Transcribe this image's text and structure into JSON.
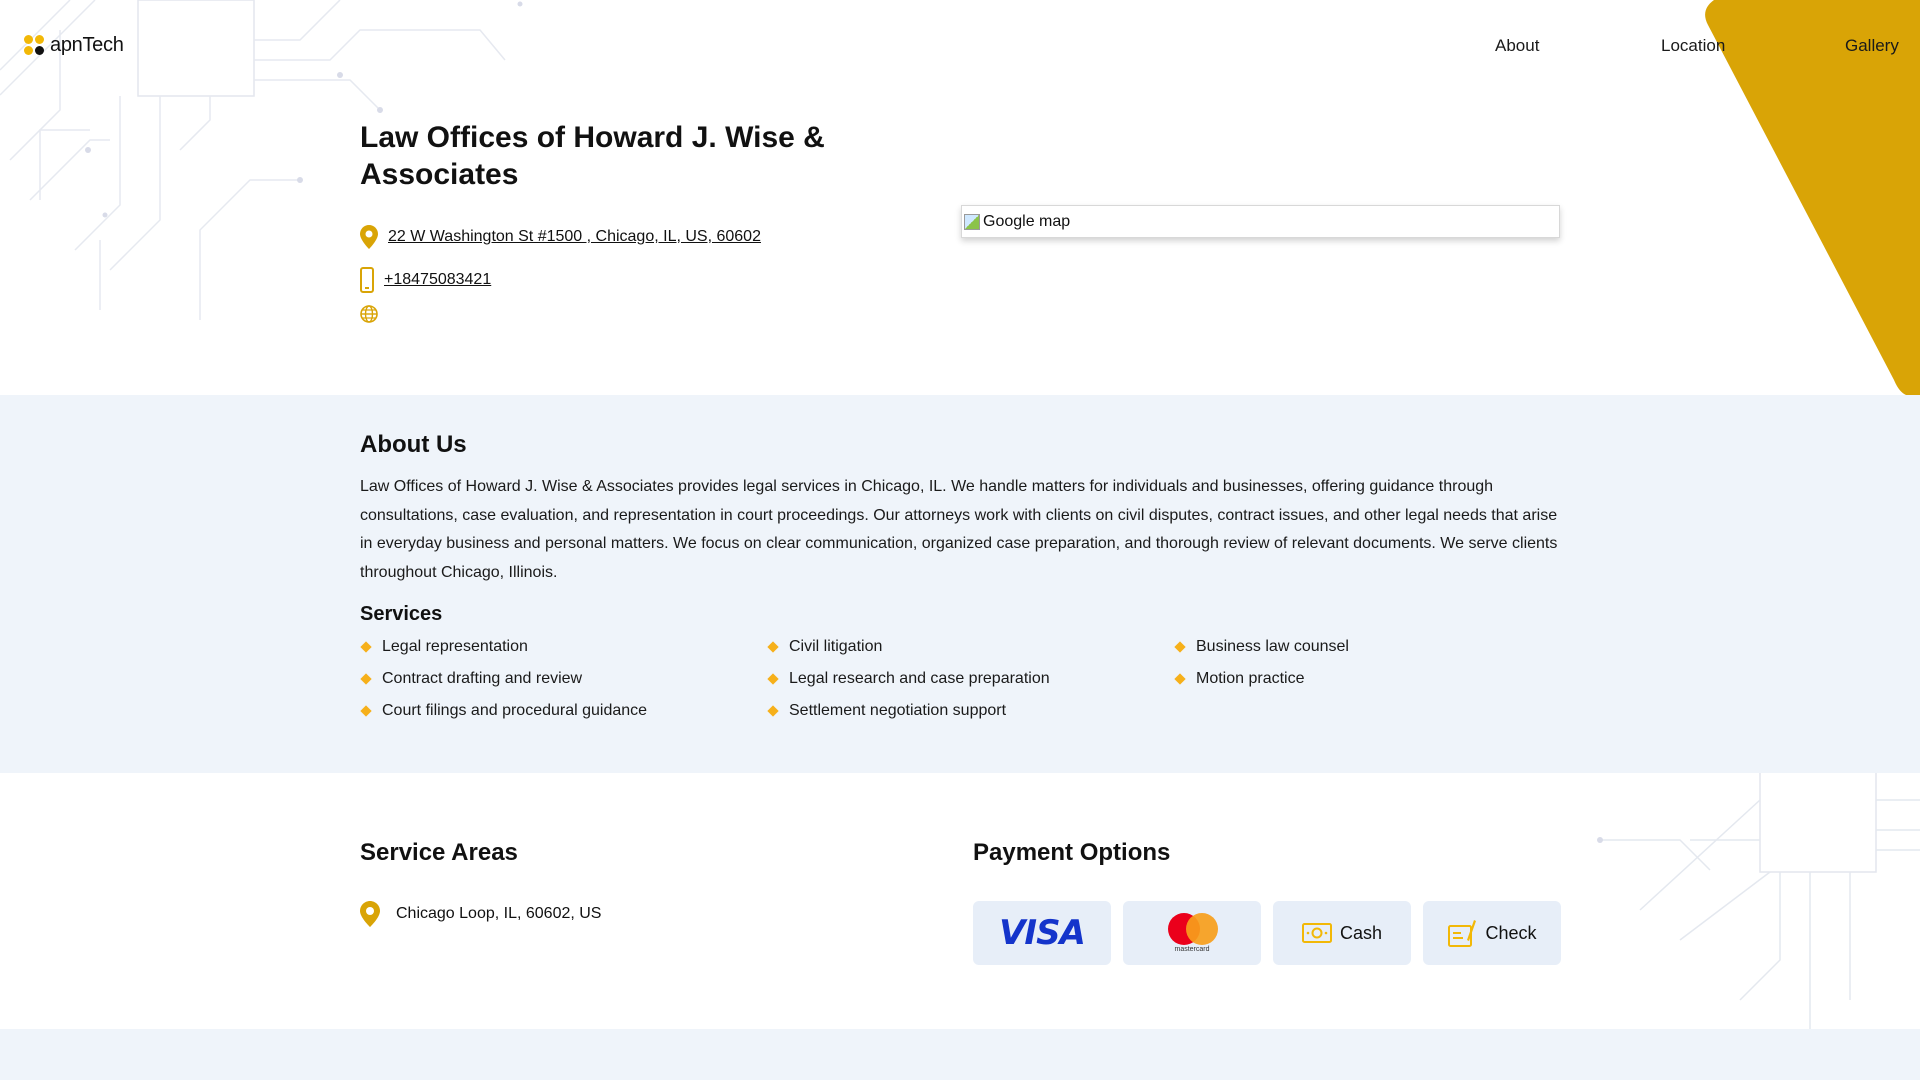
{
  "brand": {
    "logo_text": "apnTech"
  },
  "nav": {
    "about": "About",
    "location": "Location",
    "gallery": "Gallery"
  },
  "business": {
    "name": "Law Offices of Howard J. Wise & Associates",
    "address": "22 W Washington St #1500 , Chicago, IL, US, 60602",
    "phone": "+18475083421",
    "map_alt": "Google map"
  },
  "about": {
    "heading": "About Us",
    "text": "Law Offices of Howard J. Wise & Associates provides legal services in Chicago, IL. We handle matters for individuals and businesses, offering guidance through consultations, case evaluation, and representation in court proceedings. Our attorneys work with clients on civil disputes, contract issues, and other legal needs that arise in everyday business and personal matters. We focus on clear communication, organized case preparation, and thorough review of relevant documents. We serve clients throughout Chicago, Illinois."
  },
  "services": {
    "heading": "Services",
    "items": [
      "Legal representation",
      "Civil litigation",
      "Business law counsel",
      "Contract drafting and review",
      "Legal research and case preparation",
      "Motion practice",
      "Court filings and procedural guidance",
      "Settlement negotiation support"
    ]
  },
  "service_areas": {
    "heading": "Service Areas",
    "items": [
      "Chicago Loop, IL, 60602, US"
    ]
  },
  "payment": {
    "heading": "Payment Options",
    "visa": "VISA",
    "mastercard": "mastercard",
    "cash": "Cash",
    "check": "Check"
  },
  "colors": {
    "accent": "#d9a406",
    "panel_bg": "#eff4fa",
    "card_bg": "#e7eef8"
  },
  "icons": {
    "address": "map-pin-icon",
    "phone": "phone-icon",
    "website": "globe-icon",
    "service": "diamond-bullet-icon",
    "area": "map-pin-icon",
    "cash": "cash-icon",
    "check": "check-icon"
  }
}
